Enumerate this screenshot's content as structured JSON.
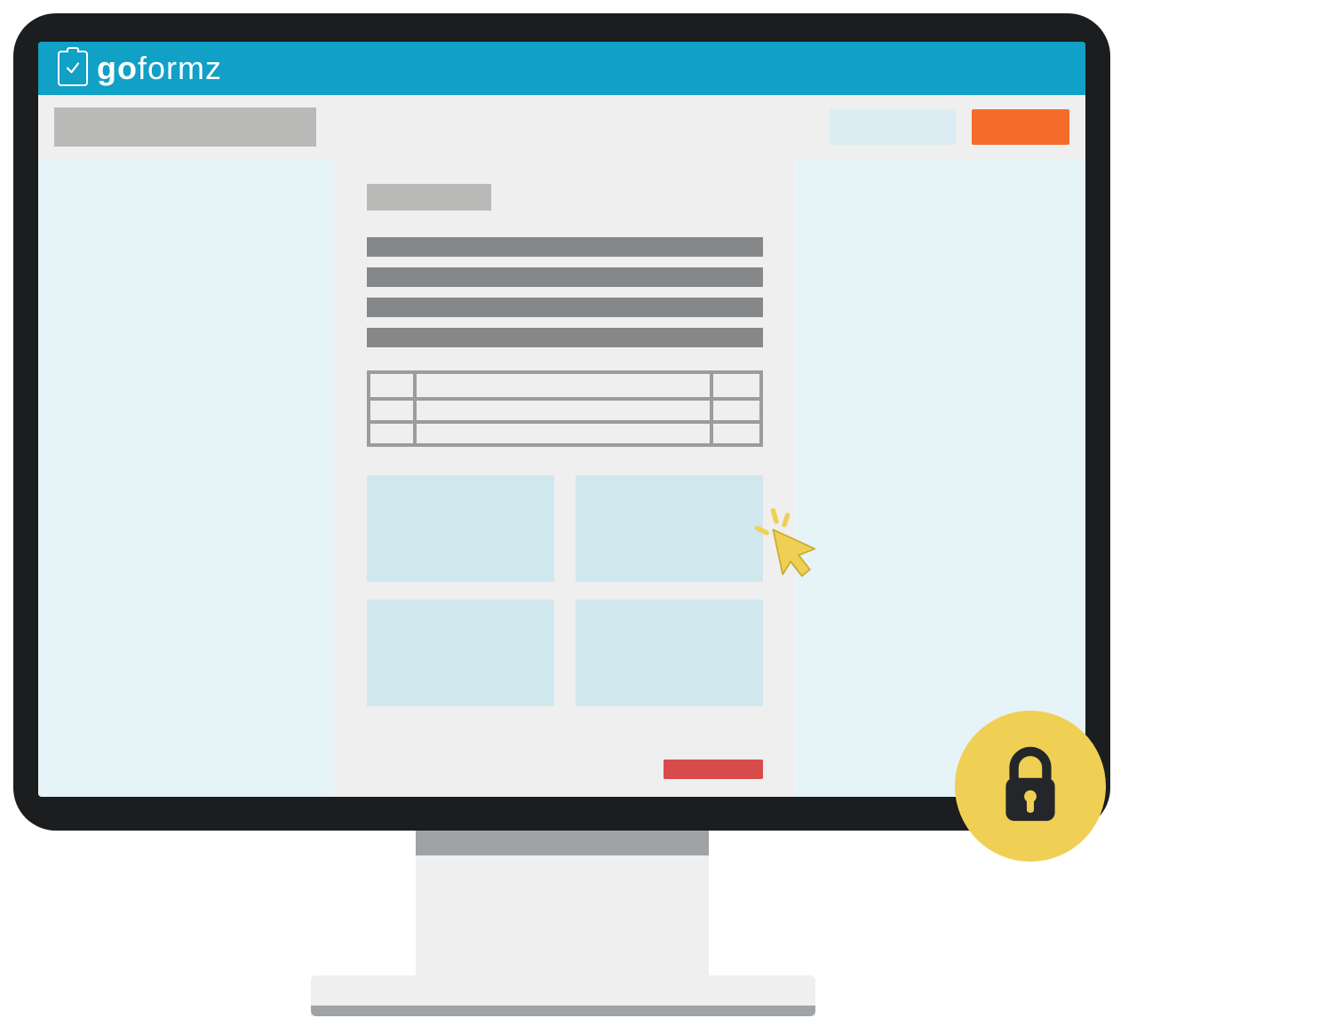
{
  "brand": {
    "name_bold": "go",
    "name_light": "formz"
  },
  "colors": {
    "header": "#11a0c6",
    "toolbar_bg": "#efefef",
    "placeholder_dark": "#858789",
    "placeholder_light": "#b9b9b8",
    "screen_bg": "#e6f3f7",
    "panel_bg": "#d0e7ed",
    "primary_button": "#f46c2a",
    "danger_button": "#d84b4b",
    "badge_yellow": "#efd054",
    "lock_dark": "#24262a"
  },
  "icons": {
    "logo_clipboard": "clipboard-check-icon",
    "cursor": "click-cursor-icon",
    "lock": "lock-icon"
  },
  "document": {
    "line_count": 4,
    "table_rows": 3,
    "panel_count": 4
  }
}
